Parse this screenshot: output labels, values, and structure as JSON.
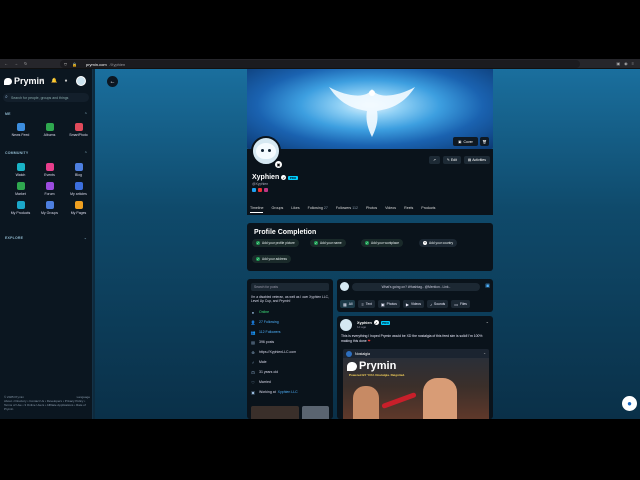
{
  "browser": {
    "domain": "prymin.com",
    "path": "/Xyphien"
  },
  "app": {
    "logo_text": "Prymin",
    "search_placeholder": "Search for people, groups and things",
    "me_section": "ME",
    "me_items": [
      {
        "label": "News Feed",
        "color": "#3c8dde"
      },
      {
        "label": "Albums",
        "color": "#2fa84f"
      },
      {
        "label": "SmartPhoto",
        "color": "#e14a5b"
      }
    ],
    "community_section": "COMMUNITY",
    "community_items": [
      {
        "label": "Watch",
        "color": "#19b3c6"
      },
      {
        "label": "Events",
        "color": "#e83e8c"
      },
      {
        "label": "Blog",
        "color": "#4d7fe0"
      },
      {
        "label": "Market",
        "color": "#2fa84f"
      },
      {
        "label": "Forum",
        "color": "#9c4ce0"
      },
      {
        "label": "My articles",
        "color": "#3c6fde"
      },
      {
        "label": "My Products",
        "color": "#1ba7c9"
      },
      {
        "label": "My Groups",
        "color": "#4d7fe0"
      },
      {
        "label": "My Pages",
        "color": "#f0a020"
      }
    ],
    "explore_section": "EXPLORE",
    "footer_copyright": "© 2025 Prymin",
    "footer_language": "Language",
    "footer_links": "About • Directory • Contact Us • Developers • Privacy Policy • Terms of Use • 3 Online Users • Affiliate Applications • Rate of Prymin"
  },
  "profile": {
    "cover_button": "Cover",
    "name": "Xyphien",
    "pro_badge": "PRO",
    "handle": "@Xyphien",
    "action_edit": "Edit",
    "action_activities": "Activities",
    "tabs": [
      {
        "label": "Timeline",
        "count": ""
      },
      {
        "label": "Groups",
        "count": ""
      },
      {
        "label": "Likes",
        "count": ""
      },
      {
        "label": "Following",
        "count": "27"
      },
      {
        "label": "Followers",
        "count": "112"
      },
      {
        "label": "Photos",
        "count": ""
      },
      {
        "label": "Videos",
        "count": ""
      },
      {
        "label": "Reels",
        "count": ""
      },
      {
        "label": "Products",
        "count": ""
      }
    ]
  },
  "completion": {
    "title": "Profile Completion",
    "items": [
      {
        "label": "Add your profile picture",
        "done": true
      },
      {
        "label": "Add your name",
        "done": true
      },
      {
        "label": "Add your workplace",
        "done": true
      },
      {
        "label": "Add your country",
        "done": false
      },
      {
        "label": "Add your address",
        "done": true
      }
    ]
  },
  "about": {
    "search_placeholder": "Search for posts",
    "bio": "I'm a disabled veteran, as well as I own Xyphien LLC, Level Up Cup, and Prymin!",
    "status": "Online",
    "following": "27 Following",
    "followers": "112 Followers",
    "posts": "396 posts",
    "website": "https://XyphienLLC.com",
    "gender": "Male",
    "age": "31 years old",
    "relationship": "Married",
    "working_prefix": "Working at",
    "working_at": "Xyphien LLC"
  },
  "composer": {
    "placeholder": "What's going on? #Hashtag.. @Mention.. Link..",
    "tabs": [
      "All",
      "Text",
      "Photos",
      "Videos",
      "Sounds",
      "Files"
    ]
  },
  "post": {
    "author": "Xyphien",
    "badge": "PRO",
    "time": "1d ago",
    "text": "This is everything I hoped Prymin would be XD the nostalgia of this feed sim is solid! I'm 100% making this done",
    "embed_author": "Nostalgia",
    "embed_logo": "Prymin",
    "embed_tagline": "Powered BY YOU. Nostalgia. Reignited."
  }
}
